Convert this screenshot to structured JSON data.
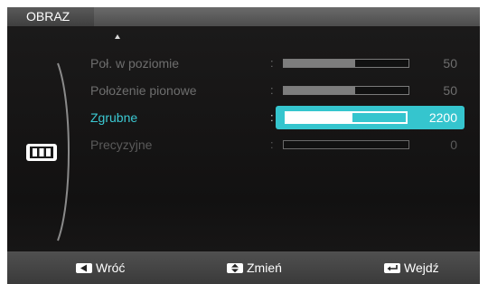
{
  "header": {
    "title": "OBRAZ"
  },
  "side_icon": "monitor-picture-icon",
  "menu": {
    "items": [
      {
        "label": "Poł. w poziomie",
        "colon": ":",
        "value": "50",
        "level": 0.57,
        "state": "normal"
      },
      {
        "label": "Położenie pionowe",
        "colon": ":",
        "value": "50",
        "level": 0.57,
        "state": "normal"
      },
      {
        "label": "Zgrubne",
        "colon": ":",
        "value": "2200",
        "level": 0.55,
        "state": "selected"
      },
      {
        "label": "Precyzyjne",
        "colon": ":",
        "value": "0",
        "level": 0.0,
        "state": "dim"
      }
    ]
  },
  "footer": {
    "back": {
      "icon": "arrow-left-key-icon",
      "label": "Wróć"
    },
    "change": {
      "icon": "arrow-up-down-key-icon",
      "label": "Zmień"
    },
    "enter": {
      "icon": "enter-key-icon",
      "label": "Wejdź"
    }
  },
  "colors": {
    "accent": "#35c5ce",
    "selected_text": "#3bc9d3",
    "background": "#141313"
  }
}
